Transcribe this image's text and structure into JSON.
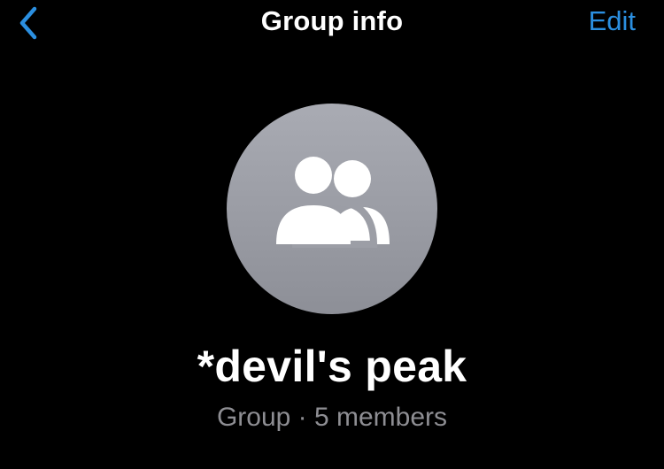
{
  "nav": {
    "title": "Group info",
    "edit_label": "Edit",
    "back_icon": "chevron-left-icon"
  },
  "profile": {
    "avatar_icon": "group-people-icon",
    "name": "*devil's peak",
    "meta": "Group · 5 members"
  },
  "colors": {
    "background": "#000000",
    "accent": "#2b8fe0",
    "avatar_bg": "#9c9ea6",
    "secondary_text": "#8e8e93"
  }
}
